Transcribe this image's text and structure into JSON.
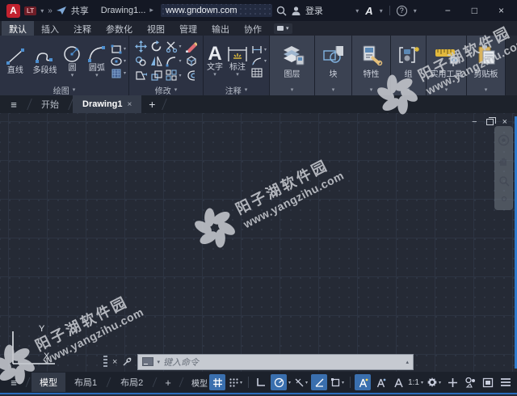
{
  "icons": {
    "caret_down": "▾",
    "caret_right": "▸",
    "caret_up": "▴",
    "plus": "+",
    "close": "×",
    "minimize": "−",
    "maximize": "□",
    "hamburger": "≡",
    "chevrons": "»"
  },
  "titlebar": {
    "logo": "A",
    "lt": "LT",
    "share": "共享",
    "doc": "Drawing1...",
    "search": "www.gndown.com",
    "login": "登录",
    "autodesk": "A",
    "help": "?"
  },
  "ribbon": {
    "tabs": [
      "默认",
      "插入",
      "注释",
      "参数化",
      "视图",
      "管理",
      "输出",
      "协作"
    ],
    "draw": {
      "label": "绘图",
      "line": "直线",
      "polyline": "多段线",
      "circle": "圆",
      "arc": "圆弧"
    },
    "modify": {
      "label": "修改"
    },
    "annotate": {
      "label": "注释",
      "text": "文字",
      "dim": "标注"
    },
    "layers": {
      "label": "图层"
    },
    "block": {
      "label": "块"
    },
    "props": {
      "label": "特性"
    },
    "group": {
      "label": "组"
    },
    "utils": {
      "label": "实用工具"
    },
    "clipboard": {
      "label": "剪贴板"
    }
  },
  "filetabs": {
    "start": "开始",
    "drawing": "Drawing1"
  },
  "ucs": {
    "x": "X",
    "y": "Y"
  },
  "watermark": {
    "line1": "阳子湖软件园",
    "line2": "www.yangzihu.com"
  },
  "command": {
    "placeholder": "键入命令"
  },
  "status": {
    "model_tab": "模型",
    "layout1": "布局1",
    "layout2": "布局2",
    "model_btn": "模型",
    "scale": "1:1"
  }
}
